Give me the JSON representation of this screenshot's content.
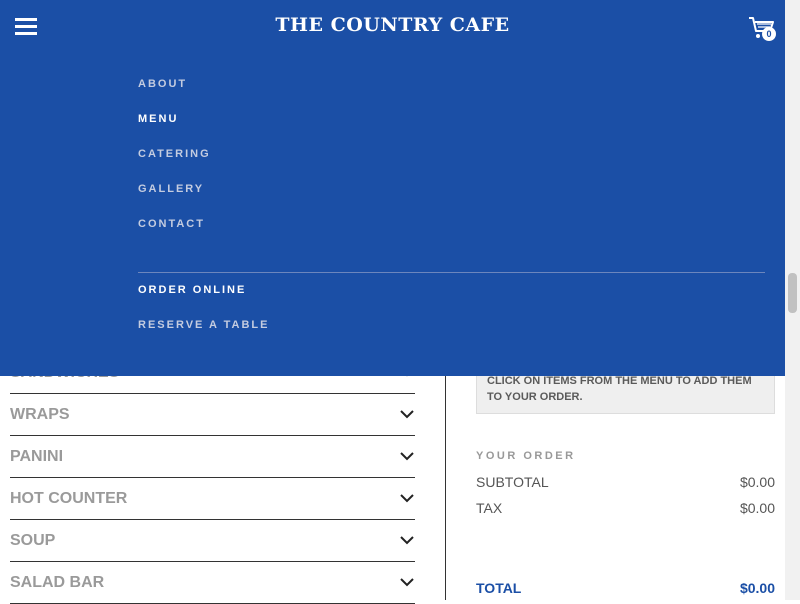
{
  "header": {
    "logo": "THE COUNTRY CAFE",
    "cart_count": "0"
  },
  "nav": {
    "items": [
      {
        "label": "ABOUT"
      },
      {
        "label": "MENU"
      },
      {
        "label": "CATERING"
      },
      {
        "label": "GALLERY"
      },
      {
        "label": "CONTACT"
      }
    ],
    "secondary": [
      {
        "label": "ORDER ONLINE"
      },
      {
        "label": "RESERVE A TABLE"
      }
    ],
    "active": "MENU"
  },
  "categories": [
    {
      "label": "SANDWICHES"
    },
    {
      "label": "WRAPS"
    },
    {
      "label": "PANINI"
    },
    {
      "label": "HOT COUNTER"
    },
    {
      "label": "SOUP"
    },
    {
      "label": "SALAD BAR"
    }
  ],
  "order": {
    "hint": "CLICK ON ITEMS FROM THE MENU TO ADD THEM TO YOUR ORDER.",
    "heading": "YOUR ORDER",
    "subtotal_label": "SUBTOTAL",
    "subtotal_value": "$0.00",
    "tax_label": "TAX",
    "tax_value": "$0.00",
    "total_label": "TOTAL",
    "total_value": "$0.00"
  },
  "colors": {
    "brand_blue": "#1b4fa6"
  }
}
